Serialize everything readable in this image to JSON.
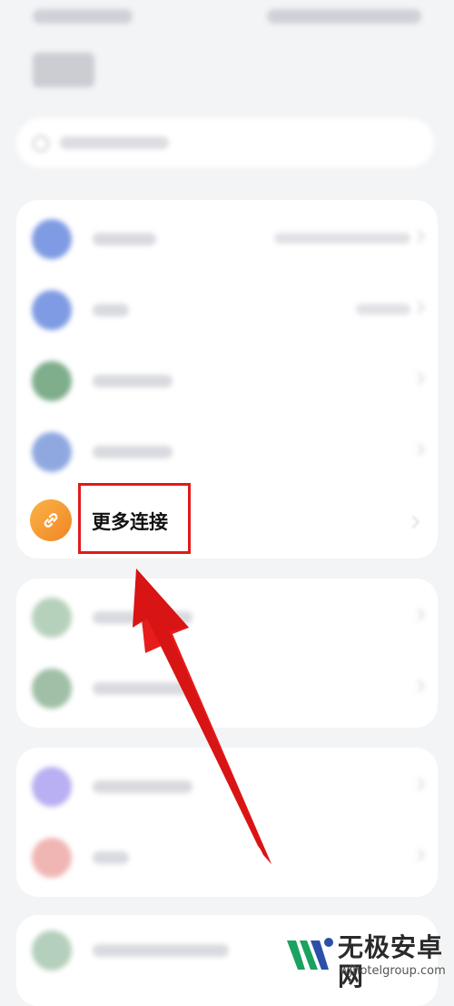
{
  "settings_list": {
    "highlighted_item": {
      "label": "更多连接",
      "icon": "link-icon",
      "icon_color": "#f39a30"
    },
    "blurred_groups": 4
  },
  "annotation": {
    "box_color": "#e01a1a",
    "arrow_color": "#e81c1c"
  },
  "watermark": {
    "title": "无极安卓网",
    "url": "wjhotelgroup.com",
    "logo": "wj-logo-icon",
    "logo_colors": [
      "#1aa260",
      "#2c4fa8"
    ]
  }
}
